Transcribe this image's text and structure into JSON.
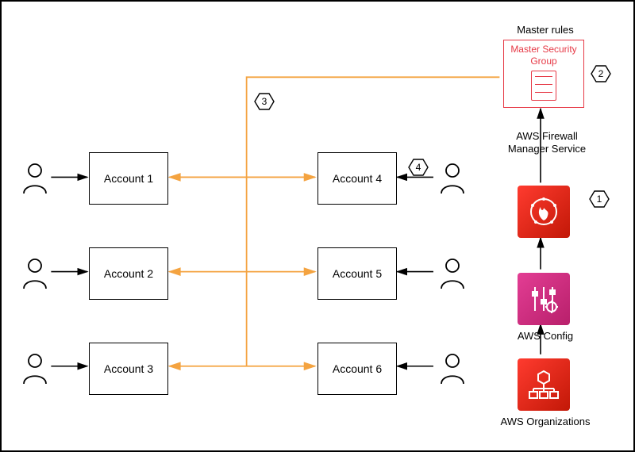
{
  "title_master_rules": "Master rules",
  "master_security_group": "Master Security\nGroup",
  "label_fms": "AWS Firewall\nManager Service",
  "label_config": "AWS Config",
  "label_orgs": "AWS Organizations",
  "accounts": {
    "a1": "Account 1",
    "a2": "Account 2",
    "a3": "Account 3",
    "a4": "Account 4",
    "a5": "Account 5",
    "a6": "Account 6"
  },
  "callouts": {
    "c1": "1",
    "c2": "2",
    "c3": "3",
    "c4": "4"
  },
  "chart_data": {
    "type": "diagram",
    "nodes": [
      {
        "id": "acct1",
        "label": "Account 1",
        "kind": "account"
      },
      {
        "id": "acct2",
        "label": "Account 2",
        "kind": "account"
      },
      {
        "id": "acct3",
        "label": "Account 3",
        "kind": "account"
      },
      {
        "id": "acct4",
        "label": "Account 4",
        "kind": "account"
      },
      {
        "id": "acct5",
        "label": "Account 5",
        "kind": "account"
      },
      {
        "id": "acct6",
        "label": "Account 6",
        "kind": "account"
      },
      {
        "id": "user1",
        "label": "User 1",
        "kind": "user"
      },
      {
        "id": "user2",
        "label": "User 2",
        "kind": "user"
      },
      {
        "id": "user3",
        "label": "User 3",
        "kind": "user"
      },
      {
        "id": "user4",
        "label": "User 4",
        "kind": "user"
      },
      {
        "id": "user5",
        "label": "User 5",
        "kind": "user"
      },
      {
        "id": "user6",
        "label": "User 6",
        "kind": "user"
      },
      {
        "id": "msg",
        "label": "Master Security Group",
        "kind": "security-group",
        "group": "Master rules"
      },
      {
        "id": "fms",
        "label": "AWS Firewall Manager Service",
        "kind": "service"
      },
      {
        "id": "config",
        "label": "AWS Config",
        "kind": "service"
      },
      {
        "id": "orgs",
        "label": "AWS Organizations",
        "kind": "service"
      }
    ],
    "edges": [
      {
        "from": "user1",
        "to": "acct1",
        "style": "black-arrow"
      },
      {
        "from": "user2",
        "to": "acct2",
        "style": "black-arrow"
      },
      {
        "from": "user3",
        "to": "acct3",
        "style": "black-arrow"
      },
      {
        "from": "user4",
        "to": "acct4",
        "style": "black-arrow"
      },
      {
        "from": "user5",
        "to": "acct5",
        "style": "black-arrow"
      },
      {
        "from": "user6",
        "to": "acct6",
        "style": "black-arrow"
      },
      {
        "from": "orgs",
        "to": "config",
        "style": "black-arrow"
      },
      {
        "from": "config",
        "to": "fms",
        "style": "black-arrow"
      },
      {
        "from": "fms",
        "to": "msg",
        "style": "black-arrow"
      },
      {
        "from": "msg",
        "to": "acct1",
        "style": "orange-bidir",
        "via": "bus"
      },
      {
        "from": "msg",
        "to": "acct2",
        "style": "orange-bidir",
        "via": "bus"
      },
      {
        "from": "msg",
        "to": "acct3",
        "style": "orange-bidir",
        "via": "bus"
      },
      {
        "from": "msg",
        "to": "acct4",
        "style": "orange-bidir",
        "via": "bus"
      },
      {
        "from": "msg",
        "to": "acct5",
        "style": "orange-bidir",
        "via": "bus"
      },
      {
        "from": "msg",
        "to": "acct6",
        "style": "orange-bidir",
        "via": "bus"
      }
    ],
    "callouts": [
      {
        "num": 1,
        "near": "fms"
      },
      {
        "num": 2,
        "near": "msg"
      },
      {
        "num": 3,
        "near": "bus"
      },
      {
        "num": 4,
        "near": "acct4"
      }
    ]
  }
}
